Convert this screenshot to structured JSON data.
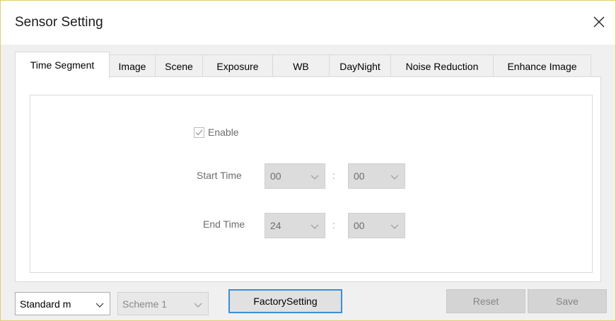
{
  "window": {
    "title": "Sensor Setting"
  },
  "tabs": [
    {
      "label": "Time Segment",
      "active": true
    },
    {
      "label": "Image"
    },
    {
      "label": "Scene"
    },
    {
      "label": "Exposure"
    },
    {
      "label": "WB"
    },
    {
      "label": "DayNight"
    },
    {
      "label": "Noise Reduction"
    },
    {
      "label": "Enhance Image"
    }
  ],
  "time_segment": {
    "enable_label": "Enable",
    "enable_checked": true,
    "start_time_label": "Start Time",
    "start_hour": "00",
    "start_minute": "00",
    "end_time_label": "End Time",
    "end_hour": "24",
    "end_minute": "00",
    "separator": ":"
  },
  "footer": {
    "mode_select": "Standard m",
    "scheme_select": "Scheme 1",
    "factory_button": "FactorySetting",
    "reset_button": "Reset",
    "save_button": "Save"
  },
  "colors": {
    "window_border": "#e3cf6a",
    "focus_border": "#3c8fd6",
    "disabled_text": "#6d6d6d"
  }
}
